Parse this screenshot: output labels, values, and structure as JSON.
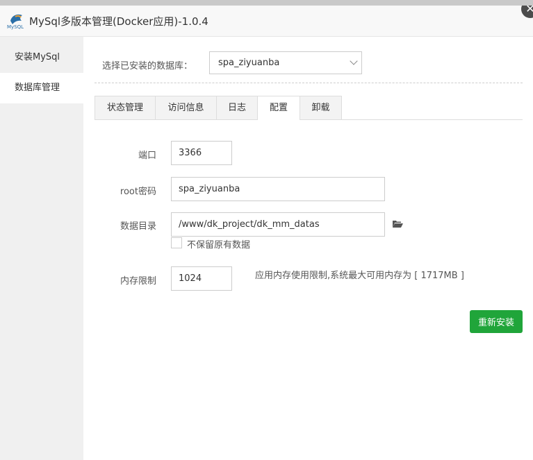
{
  "window": {
    "title": "MySql多版本管理(Docker应用)-1.0.4",
    "logo_text": "MySQL"
  },
  "sidebar": {
    "items": [
      {
        "label": "安装MySql"
      },
      {
        "label": "数据库管理"
      }
    ]
  },
  "main": {
    "select_label": "选择已安装的数据库：",
    "selected_db": "spa_ziyuanba",
    "tabs": [
      {
        "label": "状态管理"
      },
      {
        "label": "访问信息"
      },
      {
        "label": "日志"
      },
      {
        "label": "配置"
      },
      {
        "label": "卸载"
      }
    ],
    "form": {
      "port_label": "端口",
      "port_value": "3366",
      "root_pw_label": "root密码",
      "root_pw_value": "spa_ziyuanba",
      "data_dir_label": "数据目录",
      "data_dir_value": "/www/dk_project/dk_mm_datas",
      "keep_data_label": "不保留原有数据",
      "mem_label": "内存限制",
      "mem_value": "1024",
      "mem_hint": "应用内存使用限制,系统最大可用内存为 [ 1717MB ]"
    },
    "reinstall_label": "重新安装"
  },
  "colors": {
    "accent_green": "#20a53a",
    "close_button": "#4c4c4c"
  },
  "icons": {
    "logo": "mysql-logo-icon",
    "close": "close-icon",
    "folder": "folder-open-icon",
    "chevron": "chevron-down-icon"
  }
}
